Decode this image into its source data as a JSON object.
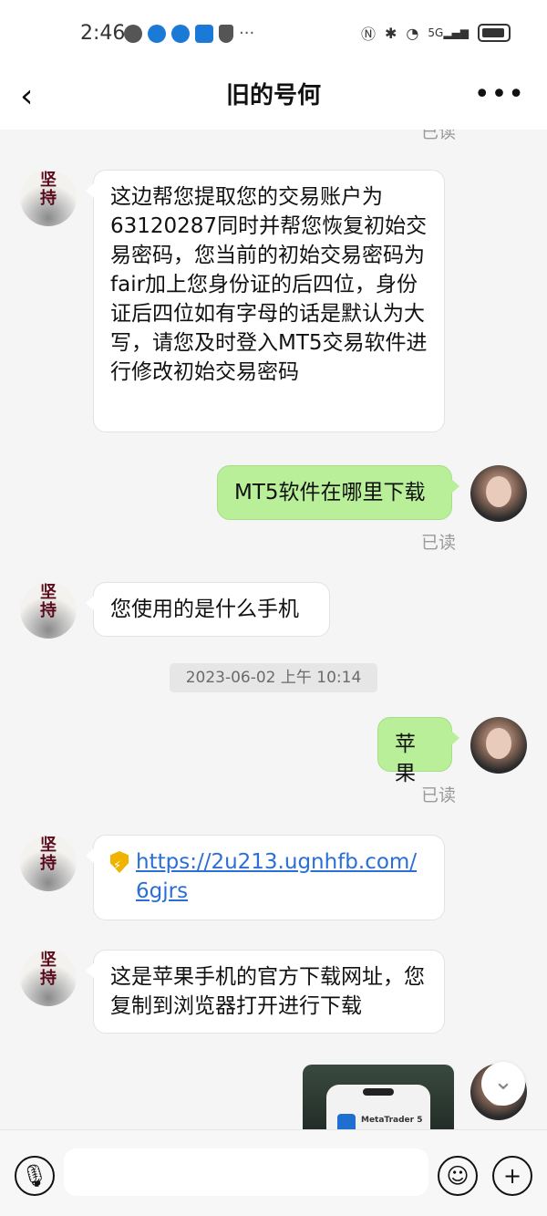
{
  "status_bar": {
    "time": "2:46",
    "network": "5G"
  },
  "header": {
    "title": "旧的号何",
    "back_icon": "chevron-left-icon",
    "more_icon": "more-horizontal-icon"
  },
  "avatars": {
    "left_glyph": "坚持"
  },
  "messages": {
    "m1": {
      "side": "left",
      "text": "这边帮您提取您的交易账户为63120287同时并帮您恢复初始交易密码，您当前的初始交易密码为fair加上您身份证的后四位，身份证后四位如有字母的话是默认为大写，请您及时登入MT5交易软件进行修改初始交易密码"
    },
    "m2": {
      "side": "right",
      "text": "MT5软件在哪里下载",
      "status": "已读"
    },
    "m3": {
      "side": "left",
      "text": "您使用的是什么手机"
    },
    "ts1": "2023-06-02 上午 10:14",
    "m4": {
      "side": "right",
      "text": "苹果",
      "status": "已读"
    },
    "m5": {
      "side": "left",
      "link": "https://2u213.ugnhfb.com/6gjrs",
      "icon": "shield-icon"
    },
    "m6": {
      "side": "left",
      "text": "这是苹果手机的官方下载网址，您复制到浏览器打开进行下载"
    },
    "m7": {
      "side": "right",
      "type": "image",
      "caption": "MetaTrader 5"
    }
  },
  "top_partial_status": "已读",
  "input_bar": {
    "voice_icon": "microphone-icon",
    "emoji_icon": "emoji-icon",
    "plus_icon": "plus-icon"
  },
  "colors": {
    "sent_bubble": "#b8ef98",
    "received_bubble": "#ffffff",
    "link": "#2a6fd6",
    "background": "#f5f5f5"
  }
}
